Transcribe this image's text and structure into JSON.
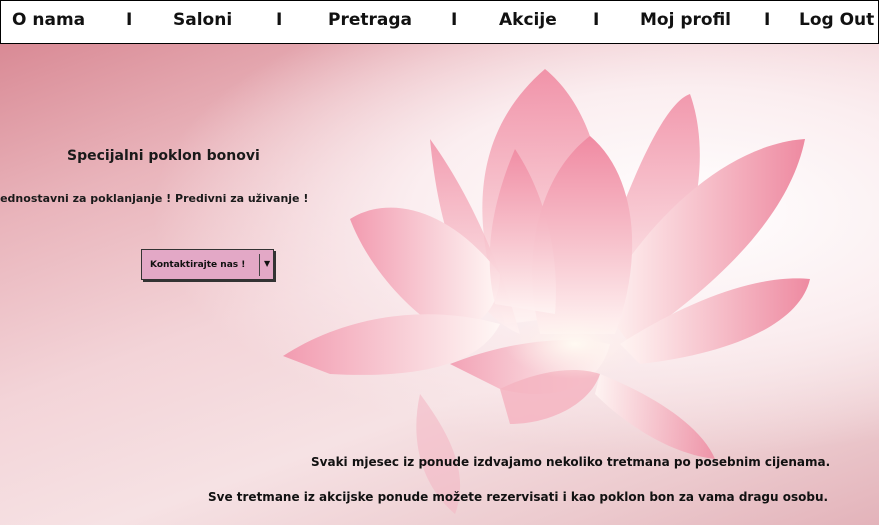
{
  "nav": {
    "items": [
      "O nama",
      "Saloni",
      "Pretraga",
      "Akcije",
      "Moj profil",
      "Log Out"
    ],
    "separator": "I"
  },
  "hero": {
    "title": "Specijalni poklon bonovi",
    "subtitle": "Jednostavni za poklanjanje ! Predivni za uživanje !",
    "button_label": "Kontaktirajte nas !",
    "promo_line_1": "Svaki mjesec iz ponude izdvajamo nekoliko tretmana po posebnim cijenama.",
    "promo_line_2": "Sve tretmane iz akcijske ponude možete rezervisati i kao poklon bon za vama dragu osobu."
  },
  "colors": {
    "button": "#e3a8c6",
    "petal": "#f0a3b3",
    "background": "#e9b4bb"
  },
  "icons": {
    "button_caret": "caret-down-icon",
    "hero_image": "lotus-flower"
  }
}
